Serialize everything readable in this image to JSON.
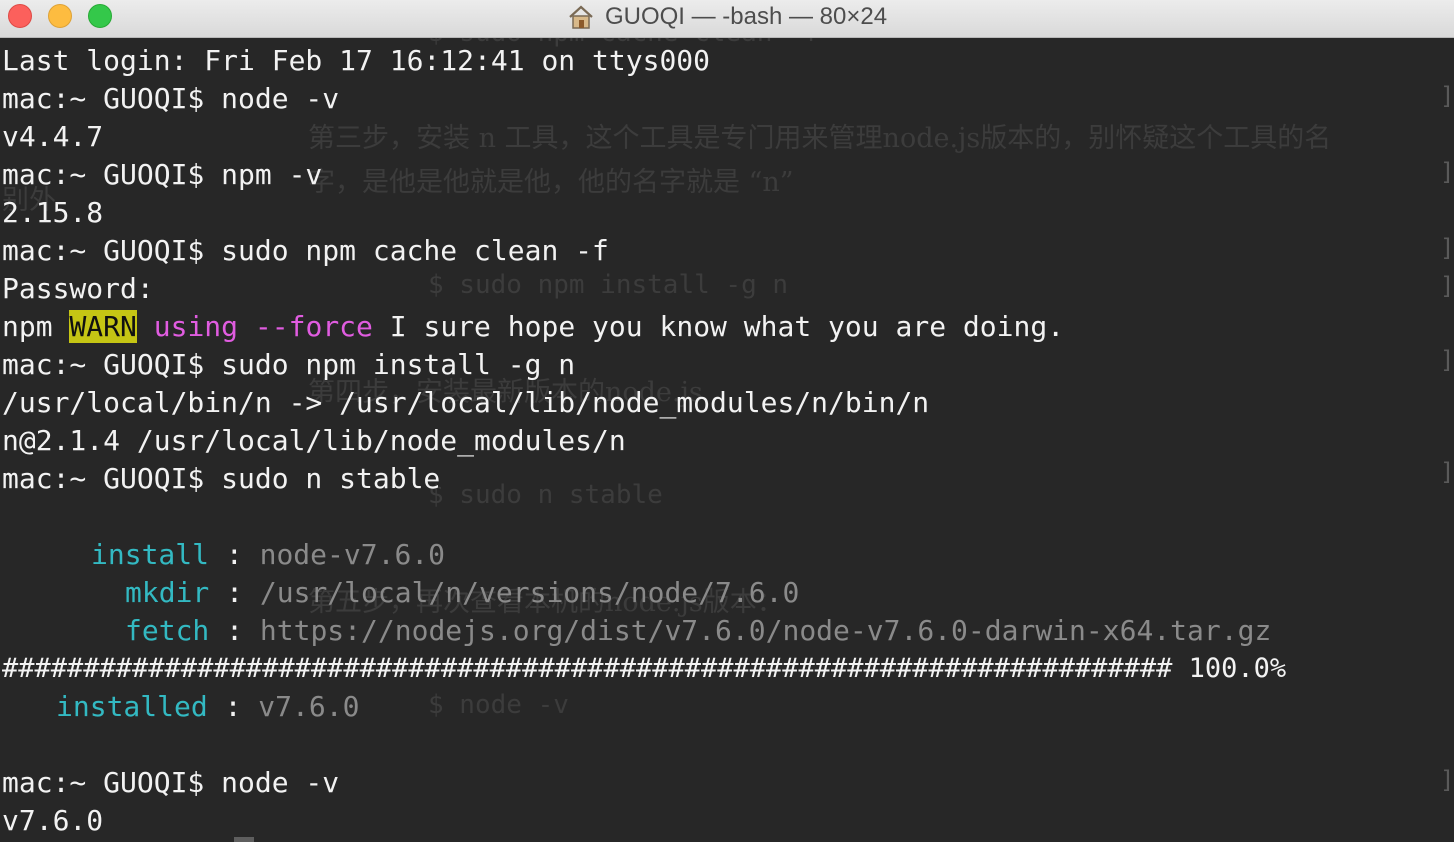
{
  "window": {
    "title": "GUOQI — -bash — 80×24",
    "title_icon": "home-icon"
  },
  "terminal": {
    "lines": [
      "Last login: Fri Feb 17 16:12:41 on ttys000",
      "mac:~ GUOQI$ node -v",
      "v4.4.7",
      "mac:~ GUOQI$ npm -v",
      "2.15.8",
      "mac:~ GUOQI$ sudo npm cache clean -f",
      "Password:",
      {
        "npm": "npm ",
        "warn": "WARN",
        "using": "using",
        "force": "--force",
        "rest": " I sure hope you know what you are doing."
      },
      "mac:~ GUOQI$ sudo npm install -g n",
      "/usr/local/bin/n -> /usr/local/lib/node_modules/n/bin/n",
      "n@2.1.4 /usr/local/lib/node_modules/n",
      "mac:~ GUOQI$ sudo n stable"
    ],
    "install_rows": [
      {
        "key": "install",
        "value": "node-v7.6.0"
      },
      {
        "key": "mkdir",
        "value": "/usr/local/n/versions/node/7.6.0"
      },
      {
        "key": "fetch",
        "value": "https://nodejs.org/dist/v7.6.0/node-v7.6.0-darwin-x64.tar.gz"
      }
    ],
    "progress_bar": "######################################################################## 100.0%",
    "installed": {
      "key": "installed",
      "value": "v7.6.0"
    },
    "final_lines": [
      "mac:~ GUOQI$ node -v",
      "v7.6.0"
    ],
    "background_ghost": {
      "cache_cmd": "$ sudo npm cache clean -f",
      "step3_line1": "第三步，安装 n 工具，这个工具是专门用来管理node.js版本的，别怀疑这个工具的名",
      "step3_line2": "字，是他是他就是他，他的名字就是 “n”",
      "step3_overlap": "别外",
      "install_cmd": "$ sudo npm install -g n",
      "step4": "第四步，安装最新版本的node.js",
      "stable_cmd": "$ sudo n stable",
      "step5": "第五步，再次查看本机的node.js版本：",
      "nodev_cmd": "$ node -v"
    }
  },
  "colors": {
    "background": "#272727",
    "text": "#f2f2f2",
    "warn_bg": "#c5c514",
    "magenta": "#e05ce0",
    "cyan": "#33b9c2",
    "gray": "#8a8a8a"
  }
}
